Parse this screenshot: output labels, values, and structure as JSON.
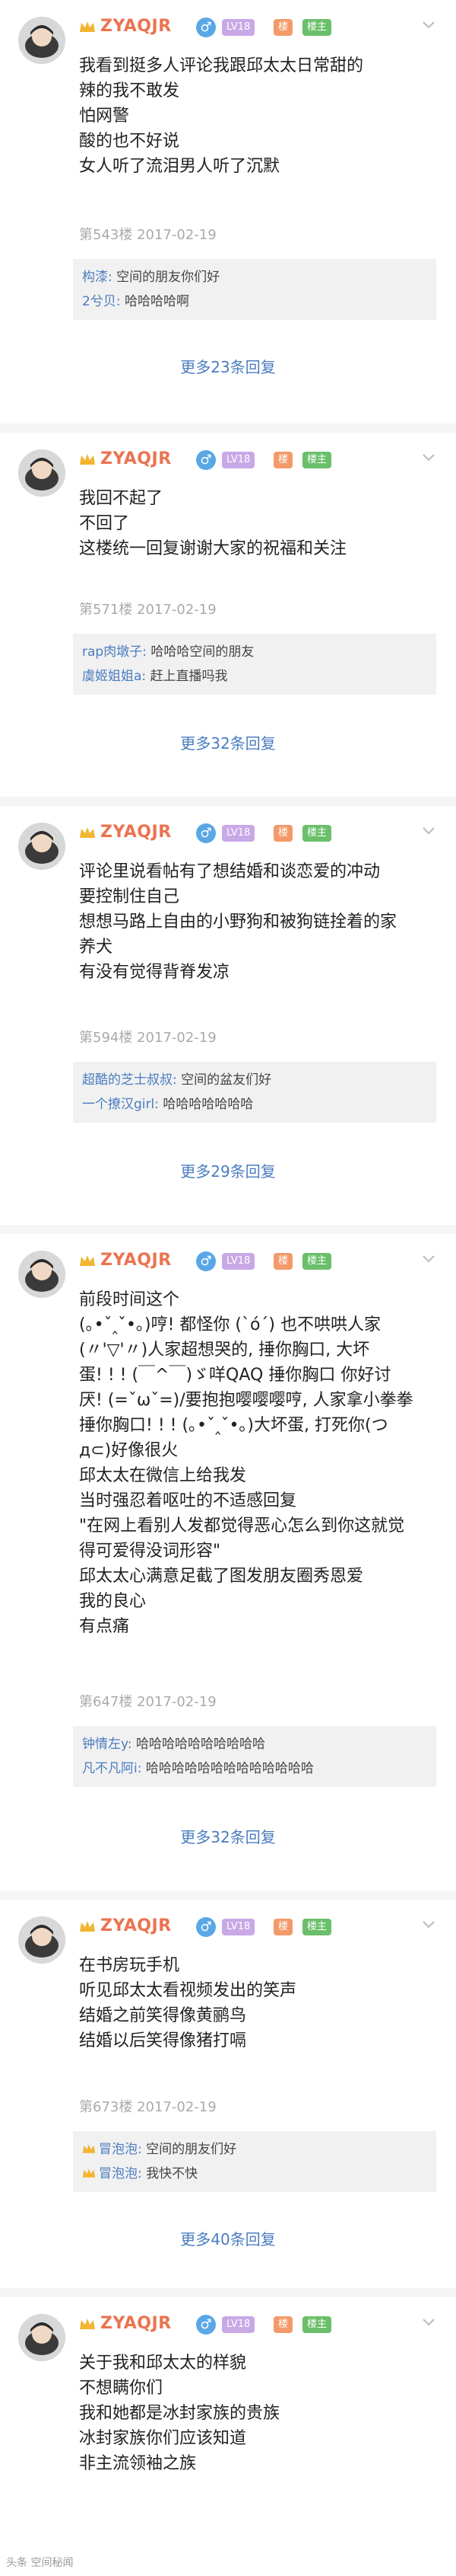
{
  "username": "ZYAQJR",
  "badges": {
    "lv": "LV18",
    "ly": "楼",
    "lz": "楼主"
  },
  "gender_symbol": "♂",
  "brand_color": "#eb7350",
  "link_color": "#4a7cc0",
  "posts": [
    {
      "lines": [
        "我看到挺多人评论我跟邱太太日常甜的",
        "辣的我不敢发",
        "怕网警",
        "酸的也不好说",
        "女人听了流泪男人听了沉默"
      ],
      "meta": "第543楼  2017-02-19",
      "replies": [
        {
          "name": "构漆:",
          "text": "空间的朋友你们好"
        },
        {
          "name": "2兮贝:",
          "text": "哈哈哈哈啊"
        }
      ],
      "more": "更多23条回复"
    },
    {
      "lines": [
        "我回不起了",
        "不回了",
        "这楼统一回复谢谢大家的祝福和关注"
      ],
      "meta": "第571楼  2017-02-19",
      "replies": [
        {
          "name": "rap肉墩子:",
          "text": "哈哈哈空间的朋友"
        },
        {
          "name": "虞姬姐姐a:",
          "text": "赶上直播吗我"
        }
      ],
      "more": "更多32条回复"
    },
    {
      "lines": [
        "评论里说看帖有了想结婚和谈恋爱的冲动",
        "要控制住自己",
        "想想马路上自由的小野狗和被狗链拴着的家",
        "养犬",
        "有没有觉得背脊发凉"
      ],
      "meta": "第594楼  2017-02-19",
      "replies": [
        {
          "name": "超酷的芝士叔叔:",
          "text": "空间的盆友们好"
        },
        {
          "name": "一个撩汉girl:",
          "text": "哈哈哈哈哈哈哈"
        }
      ],
      "more": "更多29条回复"
    },
    {
      "lines": [
        "前段时间这个",
        "(｡•ˇ‸ˇ•｡)哼! 都怪你 (`ó´) 也不哄哄人家",
        "(〃'▽'〃)人家超想哭的, 捶你胸口, 大坏",
        "蛋! ! ! (￣^￣)ゞ咩QAQ 捶你胸口 你好讨",
        "厌! (=ˇωˇ=)/要抱抱嘤嘤嘤哼, 人家拿小拳拳",
        "捶你胸口! ! ! (｡•ˇ‸ˇ•｡)大坏蛋, 打死你(つ",
        "д⊂)好像很火",
        "邱太太在微信上给我发",
        "当时强忍着呕吐的不适感回复",
        "\"在网上看别人发都觉得恶心怎么到你这就觉",
        "得可爱得没词形容\"",
        "邱太太心满意足截了图发朋友圈秀恩爱",
        "我的良心",
        "有点痛"
      ],
      "meta": "第647楼  2017-02-19",
      "replies": [
        {
          "name": "钟情左y:",
          "text": "哈哈哈哈哈哈哈哈哈哈"
        },
        {
          "name": "凡不凡阿i:",
          "text": "哈哈哈哈哈哈哈哈哈哈哈哈哈"
        }
      ],
      "more": "更多32条回复"
    },
    {
      "lines": [
        "在书房玩手机",
        "听见邱太太看视频发出的笑声",
        "结婚之前笑得像黄鹂鸟",
        "结婚以后笑得像猪打嗝"
      ],
      "meta": "第673楼  2017-02-19",
      "replies": [
        {
          "name": "冒泡泡:",
          "text": "空间的朋友们好"
        },
        {
          "name": "冒泡泡:",
          "text": "我快不快"
        }
      ],
      "more": "更多40条回复"
    },
    {
      "lines": [
        "关于我和邱太太的样貌",
        "不想瞒你们",
        "我和她都是冰封家族的贵族",
        "冰封家族你们应该知道",
        "非主流领袖之族"
      ],
      "meta": "",
      "replies": [],
      "more": ""
    }
  ],
  "watermark": "头条 空间秘闻"
}
